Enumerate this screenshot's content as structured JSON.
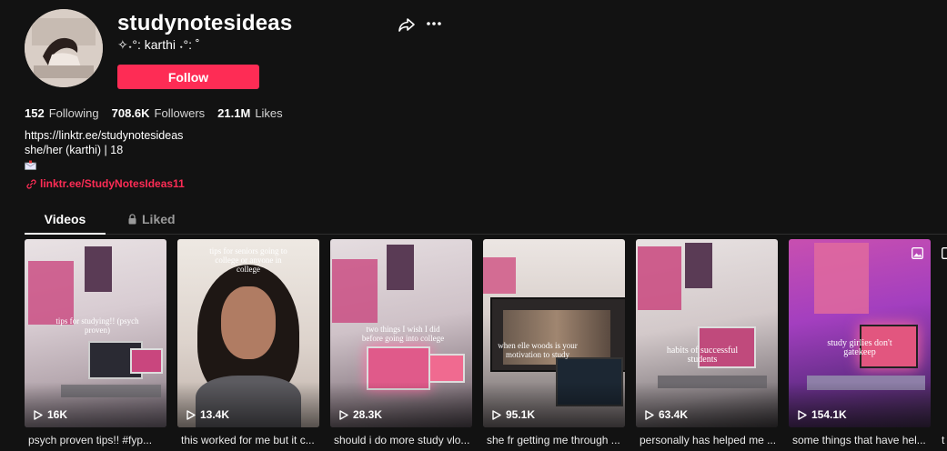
{
  "profile": {
    "username": "studynotesideas",
    "nickname": "✧˖°: karthi ˖°: ˚",
    "follow_label": "Follow",
    "stats": [
      {
        "value": "152",
        "label": "Following"
      },
      {
        "value": "708.6K",
        "label": "Followers"
      },
      {
        "value": "21.1M",
        "label": "Likes"
      }
    ],
    "bio_lines": [
      "https://linktr.ee/studynotesideas",
      "she/her (karthi) | 18"
    ],
    "link_text": "linktr.ee/StudyNotesIdeas11"
  },
  "tabs": [
    {
      "label": "Videos",
      "active": true
    },
    {
      "label": "Liked",
      "active": false,
      "icon": "lock-icon"
    }
  ],
  "videos": [
    {
      "views": "16K",
      "caption": "psych proven tips!! #fyp...",
      "overlay": "tips for studying!! (psych proven)"
    },
    {
      "views": "13.4K",
      "caption": "this worked for me but it c...",
      "overlay": "tips for seniors going to college or anyone in college"
    },
    {
      "views": "28.3K",
      "caption": "should i do more study vlo...",
      "overlay": "two things I wish I did before going into college"
    },
    {
      "views": "95.1K",
      "caption": "she fr getting me through ...",
      "overlay": "when elle woods is your motivation to study"
    },
    {
      "views": "63.4K",
      "caption": "personally has helped me ...",
      "overlay": "habits of successful students"
    },
    {
      "views": "154.1K",
      "caption": "some things that have hel...",
      "overlay": "study girlies don't gatekeep"
    },
    {
      "views": "",
      "caption": "t",
      "overlay": ""
    }
  ],
  "colors": {
    "accent": "#fe2c55",
    "background": "#121212"
  }
}
